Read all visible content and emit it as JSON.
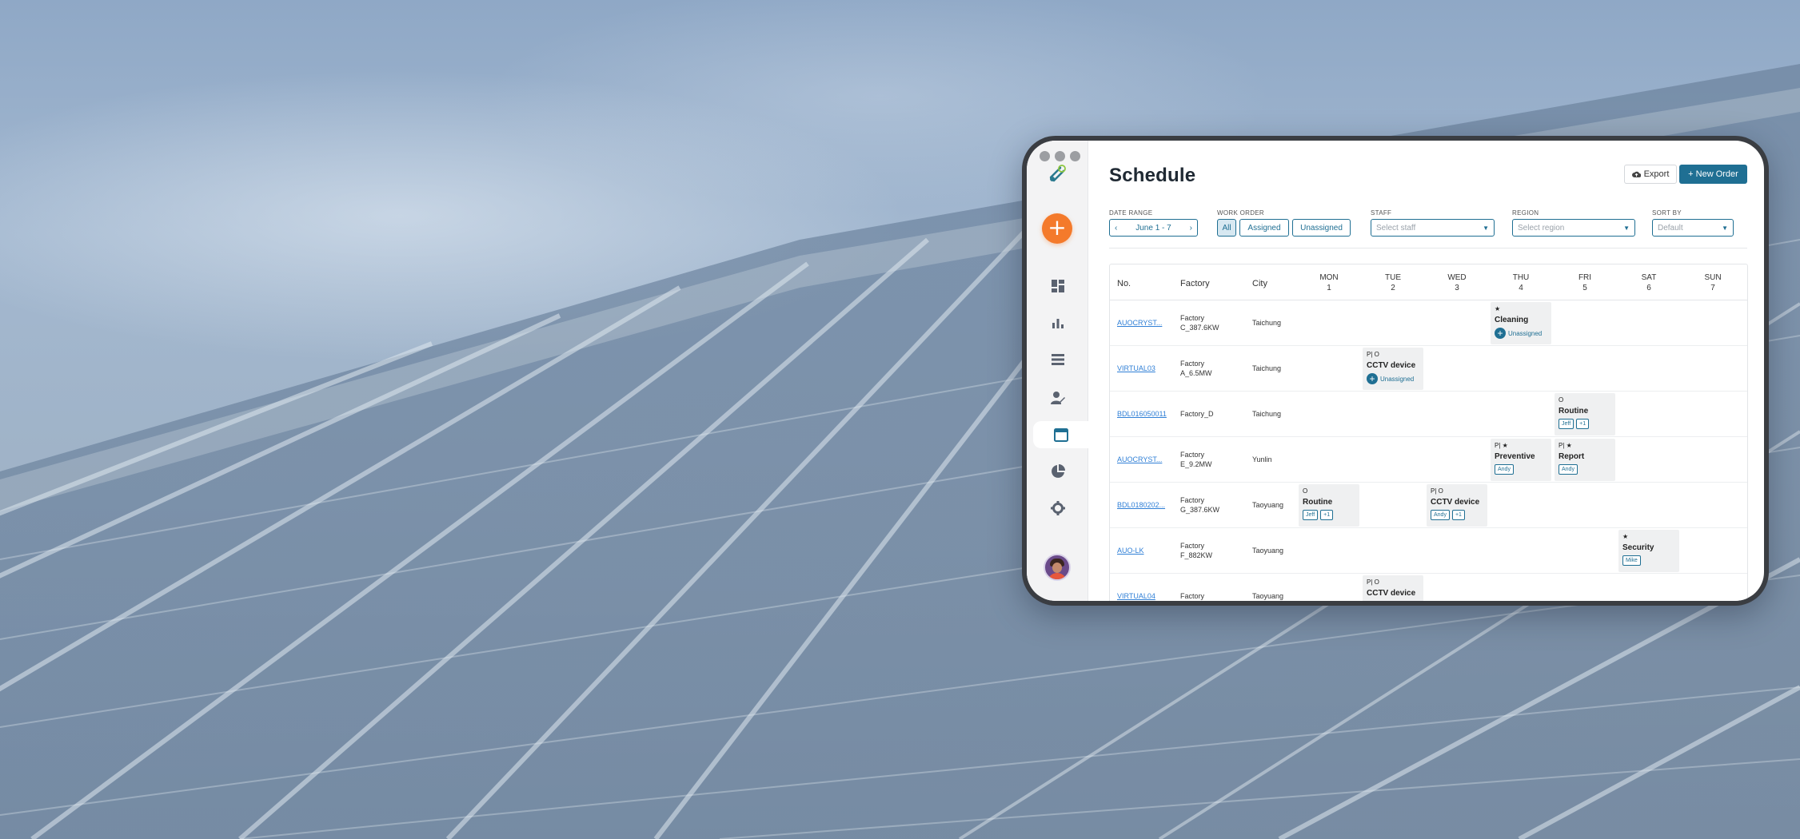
{
  "sidebar": {
    "logo_icon": "drone-logo-icon",
    "add_icon": "plus-icon",
    "items": [
      {
        "icon": "dashboard-icon"
      },
      {
        "icon": "bar-chart-icon"
      },
      {
        "icon": "list-icon"
      },
      {
        "icon": "user-edit-icon"
      },
      {
        "icon": "calendar-icon",
        "active": true
      },
      {
        "icon": "pie-chart-icon"
      },
      {
        "icon": "gear-icon"
      }
    ]
  },
  "header": {
    "title": "Schedule",
    "export_label": "Export",
    "new_order_label": "+ New Order"
  },
  "filters": {
    "date_range": {
      "label": "DATE RANGE",
      "value": "June 1 - 7",
      "prev": "‹",
      "next": "›"
    },
    "work_order": {
      "label": "WORK ORDER",
      "options": [
        "All",
        "Assigned",
        "Unassigned"
      ],
      "selected": "All"
    },
    "staff": {
      "label": "STAFF",
      "placeholder": "Select staff"
    },
    "region": {
      "label": "REGION",
      "placeholder": "Select region"
    },
    "sort_by": {
      "label": "SORT BY",
      "placeholder": "Default"
    }
  },
  "table": {
    "columns": {
      "no": "No.",
      "factory": "Factory",
      "city": "City"
    },
    "days": [
      {
        "name": "MON",
        "date": "1"
      },
      {
        "name": "TUE",
        "date": "2"
      },
      {
        "name": "WED",
        "date": "3"
      },
      {
        "name": "THU",
        "date": "4"
      },
      {
        "name": "FRI",
        "date": "5"
      },
      {
        "name": "SAT",
        "date": "6"
      },
      {
        "name": "SUN",
        "date": "7"
      }
    ],
    "rows": [
      {
        "no": "AUOCRYST...",
        "factory": [
          "Factory",
          "C_387.6KW"
        ],
        "city": "Taichung",
        "tasks": [
          {
            "day": 3,
            "icons": "★",
            "title": "Cleaning",
            "unassigned": "Unassigned"
          }
        ]
      },
      {
        "no": "VIRTUAL03",
        "factory": [
          "Factory",
          "A_6.5MW"
        ],
        "city": "Taichung",
        "tasks": [
          {
            "day": 1,
            "icons": "P| O",
            "title": "CCTV device",
            "unassigned": "Unassigned"
          }
        ]
      },
      {
        "no": "BDL016050011",
        "factory": [
          "Factory_D"
        ],
        "city": "Taichung",
        "tasks": [
          {
            "day": 4,
            "icons": "O",
            "title": "Routine",
            "chips": [
              "Jeff",
              "+1"
            ]
          }
        ]
      },
      {
        "no": "AUOCRYST...",
        "factory": [
          "Factory",
          "E_9.2MW"
        ],
        "city": "Yunlin",
        "tasks": [
          {
            "day": 3,
            "icons": "P| ★",
            "title": "Preventive",
            "chips": [
              "Andy"
            ]
          },
          {
            "day": 4,
            "icons": "P| ★",
            "title": "Report",
            "chips": [
              "Andy"
            ]
          }
        ]
      },
      {
        "no": "BDL0180202...",
        "factory": [
          "Factory",
          "G_387.6KW"
        ],
        "city": "Taoyuang",
        "tasks": [
          {
            "day": 0,
            "icons": "O",
            "title": "Routine",
            "chips": [
              "Jeff",
              "+1"
            ]
          },
          {
            "day": 2,
            "icons": "P| O",
            "title": "CCTV device",
            "chips": [
              "Andy",
              "+1"
            ]
          }
        ]
      },
      {
        "no": "AUO-LK",
        "factory": [
          "Factory",
          "F_882KW"
        ],
        "city": "Taoyuang",
        "tasks": [
          {
            "day": 5,
            "icons": "★",
            "title": "Security",
            "chips": [
              "Mike"
            ]
          }
        ]
      },
      {
        "no": "VIRTUAL04",
        "factory": [
          "Factory",
          ""
        ],
        "city": "Taoyuang",
        "tasks": [
          {
            "day": 1,
            "icons": "P| O",
            "title": "CCTV device",
            "chips": []
          }
        ]
      }
    ]
  }
}
